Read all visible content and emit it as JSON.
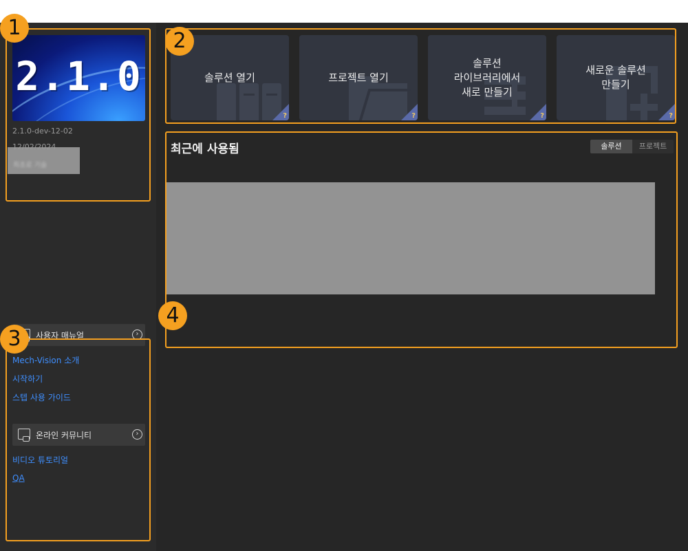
{
  "version_card": {
    "banner_text": "2.1.0",
    "build": "2.1.0-dev-12-02",
    "date": "12/02/2024",
    "redacted_text": "최초로 기술"
  },
  "sidebar": {
    "manual": {
      "title": "사용자 매뉴얼",
      "links": [
        "Mech-Vision 소개",
        "시작하기",
        "스텝 사용 가이드"
      ]
    },
    "community": {
      "title": "온라인 커뮤니티",
      "links": [
        "비디오 튜토리얼",
        "QA"
      ]
    }
  },
  "actions": [
    {
      "label": "솔루션 열기",
      "help": "?"
    },
    {
      "label": "프로젝트 열기",
      "help": "?"
    },
    {
      "label": "솔루션\n라이브러리에서\n새로 만들기",
      "help": "?"
    },
    {
      "label": "새로운 솔루션\n만들기",
      "help": "?"
    }
  ],
  "recent": {
    "title": "최근에 사용됨",
    "tabs": [
      "솔루션",
      "프로젝트"
    ],
    "active_tab": "솔루션"
  },
  "callouts": [
    "1",
    "2",
    "3",
    "4"
  ],
  "colors": {
    "accent": "#f5a020",
    "link": "#3f8fff",
    "background": "#262626",
    "card": "#323640"
  }
}
